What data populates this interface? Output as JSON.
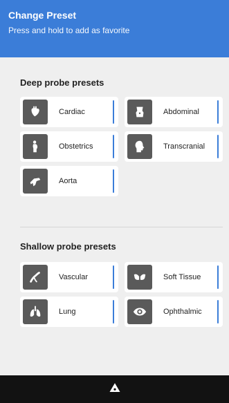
{
  "header": {
    "title": "Change Preset",
    "subtitle": "Press and hold to add as favorite"
  },
  "deep": {
    "title": "Deep probe presets",
    "items": [
      {
        "label": "Cardiac",
        "icon": "heart-icon"
      },
      {
        "label": "Abdominal",
        "icon": "abdomen-icon"
      },
      {
        "label": "Obstetrics",
        "icon": "pregnancy-icon"
      },
      {
        "label": "Transcranial",
        "icon": "head-icon"
      },
      {
        "label": "Aorta",
        "icon": "aorta-icon"
      }
    ]
  },
  "shallow": {
    "title": "Shallow probe presets",
    "items": [
      {
        "label": "Vascular",
        "icon": "vessel-icon"
      },
      {
        "label": "Soft Tissue",
        "icon": "soft-tissue-icon"
      },
      {
        "label": "Lung",
        "icon": "lungs-icon"
      },
      {
        "label": "Ophthalmic",
        "icon": "eye-icon"
      }
    ]
  },
  "colors": {
    "accent": "#3b7dd8",
    "icon_bg": "#5a5a5a",
    "page_bg": "#efefef",
    "bottom_bar": "#121212"
  },
  "bottom_bar": {
    "icon": "probe-logo-icon"
  }
}
